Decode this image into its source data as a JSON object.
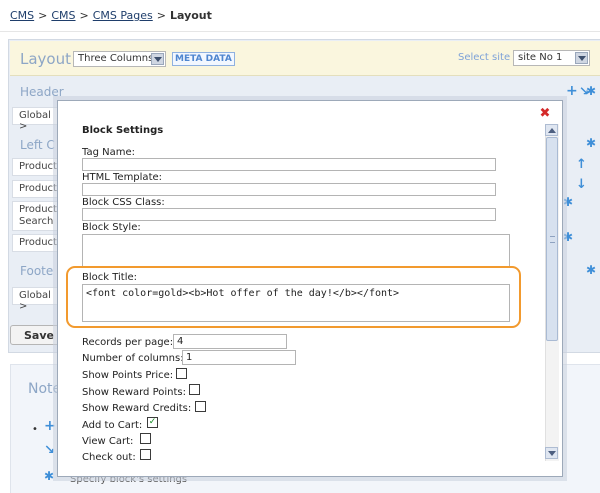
{
  "breadcrumb": {
    "items": [
      "CMS",
      "CMS",
      "CMS Pages"
    ],
    "current": "Layout"
  },
  "layout_bar": {
    "title": "Layout",
    "layout_select": "Three Columns",
    "meta_label": "META DATA",
    "site_label": "Select site",
    "site_select": "site No 1"
  },
  "sections": {
    "header": {
      "title": "Header",
      "rows": [
        "Global >"
      ]
    },
    "left": {
      "title": "Left C",
      "rows": [
        "Products",
        "Products",
        "Products\nSearch",
        "Products"
      ]
    },
    "footer": {
      "title": "Foote",
      "rows": [
        "Global >"
      ]
    }
  },
  "save_label": "Save",
  "notes": {
    "title": "Note",
    "text": "Specify block's settings"
  },
  "modal": {
    "heading": "Block Settings",
    "fields": {
      "tag_name": {
        "label": "Tag Name:",
        "value": ""
      },
      "html_template": {
        "label": "HTML Template:",
        "value": ""
      },
      "css_class": {
        "label": "Block CSS Class:",
        "value": ""
      },
      "style": {
        "label": "Block Style:",
        "value": ""
      },
      "title": {
        "label": "Block Title:",
        "value": "<font color=gold><b>Hot offer of the day!</b></font>"
      },
      "records_per_page": {
        "label": "Records per page:",
        "value": "4"
      },
      "columns": {
        "label": "Number of columns:",
        "value": "1"
      }
    },
    "checkboxes": [
      {
        "label": "Show Points Price:",
        "checked": false
      },
      {
        "label": "Show Reward Points:",
        "checked": false
      },
      {
        "label": "Show Reward Credits:",
        "checked": false
      },
      {
        "label": "Add to Cart:",
        "checked": true
      },
      {
        "label": "View Cart:",
        "checked": false
      },
      {
        "label": "Check out:",
        "checked": false
      }
    ]
  },
  "colors": {
    "accent": "#8da6c6",
    "highlight": "#f29a2e",
    "close": "#d42a2a",
    "check": "#118a1e"
  }
}
